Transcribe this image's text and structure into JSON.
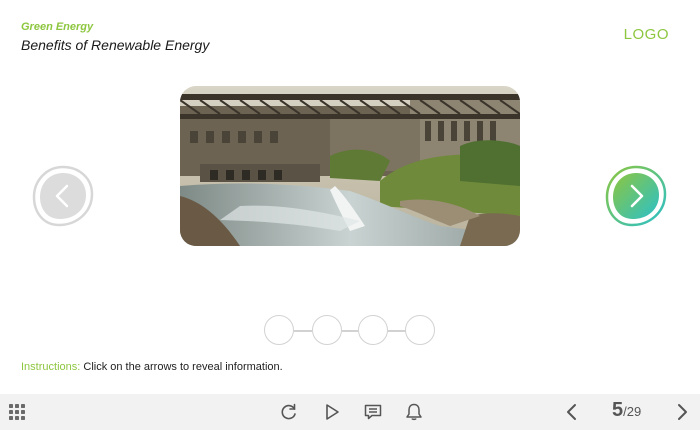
{
  "header": {
    "subtitle": "Green Energy",
    "title": "Benefits of Renewable Energy",
    "logo": "LOGO"
  },
  "image": {
    "description_icon": "hydroelectric-dam-photo"
  },
  "pagination": {
    "dot_count": 4,
    "active_index": -1
  },
  "instructions": {
    "label": "Instructions:",
    "text": " Click on the arrows to reveal information."
  },
  "toolbar": {
    "icons": [
      "menu-grid-icon",
      "replay-icon",
      "play-icon",
      "comment-icon",
      "bell-icon",
      "prev-icon",
      "next-icon"
    ],
    "page_current": "5",
    "page_total": "/29"
  },
  "colors": {
    "accent": "#8dc63f",
    "next_gradient_start": "#8dc63f",
    "next_gradient_end": "#2bc0c9",
    "muted": "#d2d2d2",
    "toolbar_bg": "#f2f2f2"
  }
}
